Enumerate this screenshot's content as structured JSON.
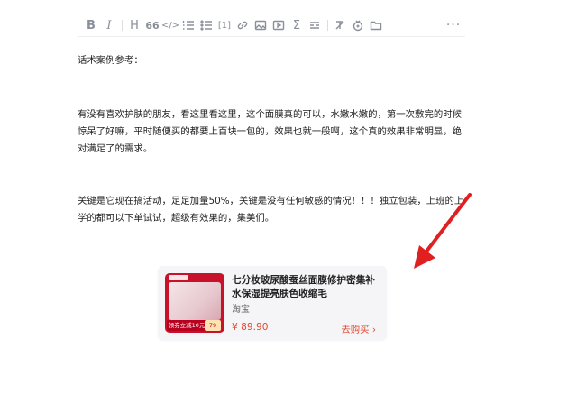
{
  "toolbar": {
    "items": [
      {
        "name": "bold-icon",
        "glyph": "B"
      },
      {
        "name": "italic-icon",
        "glyph": "I"
      },
      {
        "name": "heading-icon",
        "glyph": "H"
      },
      {
        "name": "quote-icon",
        "glyph": "66"
      },
      {
        "name": "code-icon",
        "glyph": "</>"
      },
      {
        "name": "ordered-list-icon",
        "glyph": "≡"
      },
      {
        "name": "unordered-list-icon",
        "glyph": "☰"
      },
      {
        "name": "footnote-icon",
        "glyph": "[1]"
      },
      {
        "name": "link-icon",
        "glyph": "🔗"
      },
      {
        "name": "image-icon",
        "glyph": "▣"
      },
      {
        "name": "video-icon",
        "glyph": "▶"
      },
      {
        "name": "formula-icon",
        "glyph": "Σ"
      },
      {
        "name": "divider-icon",
        "glyph": "≡"
      },
      {
        "name": "clear-format-icon",
        "glyph": "✕"
      },
      {
        "name": "goods-icon",
        "glyph": "$"
      },
      {
        "name": "folder-icon",
        "glyph": "▭"
      }
    ],
    "more_label": "···"
  },
  "article": {
    "para1": "话术案例参考：",
    "para2": "有没有喜欢护肤的朋友，看这里看这里，这个面膜真的可以，水嫩水嫩的，第一次敷完的时候惊呆了好嘛，平时随便买的都要上百块一包的，效果也就一般啊，这个真的效果非常明显，绝对满足了的需求。",
    "para3": "关键是它现在搞活动，足足加量50%，关键是没有任何敏感的情况！！！独立包装，上班的上学的都可以下单试试，超级有效果的，集美们。"
  },
  "product": {
    "title": "七分妆玻尿酸蚕丝面膜修护密集补水保湿提亮肤色收缩毛",
    "shop": "淘宝",
    "price": "¥ 89.90",
    "buy_label": "去购买 ›",
    "thumb_coupon": "领券立减10元",
    "thumb_price": "79"
  },
  "colors": {
    "accent": "#e0482f",
    "arrow": "#e02020"
  }
}
